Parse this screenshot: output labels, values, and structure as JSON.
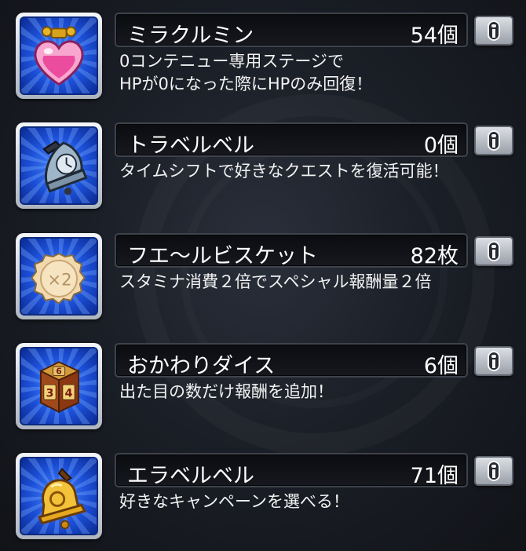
{
  "items": [
    {
      "icon": "heart-potion-icon",
      "name": "ミラクルミン",
      "count": "54個",
      "desc_line1": "0コンテニュー専用ステージで",
      "desc_line2": "HPが0になった際にHPのみ回復！"
    },
    {
      "icon": "time-bell-icon",
      "name": "トラベルベル",
      "count": "0個",
      "desc_line1": "タイムシフトで好きなクエストを復活可能！",
      "desc_line2": ""
    },
    {
      "icon": "biscuit-icon",
      "name": "フエ〜ルビスケット",
      "count": "82枚",
      "desc_line1": "スタミナ消費２倍でスペシャル報酬量２倍",
      "desc_line2": ""
    },
    {
      "icon": "dice-icon",
      "name": "おかわりダイス",
      "count": "6個",
      "desc_line1": "出た目の数だけ報酬を追加！",
      "desc_line2": ""
    },
    {
      "icon": "golden-bell-icon",
      "name": "エラベルベル",
      "count": "71個",
      "desc_line1": "好きなキャンペーンを選べる！",
      "desc_line2": ""
    }
  ],
  "biscuit_icon_text": "×2",
  "dice_faces": [
    "6",
    "3",
    "4"
  ],
  "colors": {
    "icon_bg": "#1c4fd6",
    "bar_bg": "#0b0c10",
    "text": "#ffffff"
  }
}
